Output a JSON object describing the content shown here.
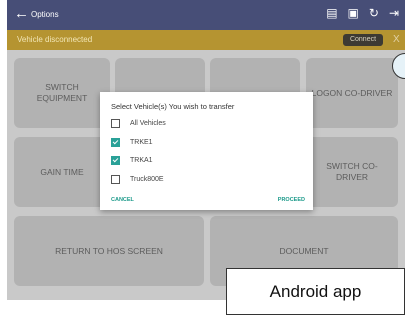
{
  "appbar": {
    "back_icon": "arrow-left-icon",
    "title": "Options",
    "icons": [
      "message-icon",
      "monitor-icon",
      "refresh-icon",
      "logout-icon"
    ]
  },
  "status": {
    "message": "Vehicle disconnected",
    "connect_label": "Connect",
    "close_label": "X",
    "color": "#b59431"
  },
  "tiles": {
    "switch_equipment": "SWITCH EQUIPMENT",
    "logon_codriver": "LOGON CO-DRIVER",
    "gain_time": "GAIN TIME",
    "switch_codriver": "SWITCH CO-DRIVER",
    "return_hos": "RETURN TO HOS SCREEN",
    "document": "DOCUMENT"
  },
  "dialog": {
    "title": "Select Vehicle(s) You wish to transfer",
    "options": [
      {
        "label": "All Vehicles",
        "checked": false
      },
      {
        "label": "TRKE1",
        "checked": true
      },
      {
        "label": "TRKA1",
        "checked": true
      },
      {
        "label": "Truck800E",
        "checked": false
      }
    ],
    "cancel": "CANCEL",
    "proceed": "PROCEED",
    "accent": "#1c9a8a"
  },
  "caption": "Android app",
  "colors": {
    "appbar": "#474e77",
    "background": "#c9c9c9"
  }
}
